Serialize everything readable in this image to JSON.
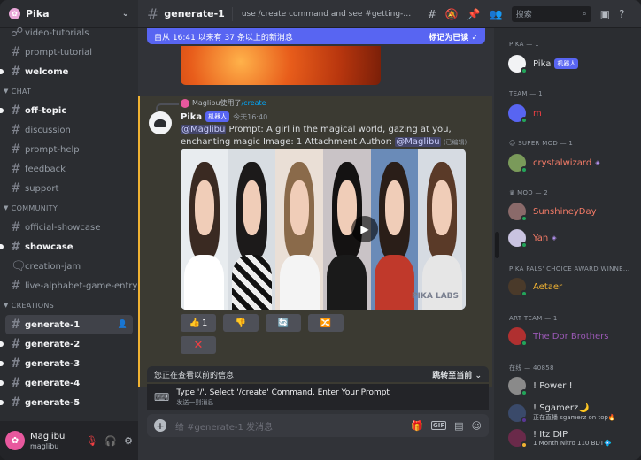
{
  "server": {
    "name": "Pika"
  },
  "sidebar": {
    "channels_top": [
      {
        "name": "video-tutorials",
        "icon": "link-icon",
        "state": "normal"
      },
      {
        "name": "prompt-tutorial",
        "icon": "hash-icon",
        "state": "normal"
      },
      {
        "name": "welcome",
        "icon": "hash-icon",
        "state": "unread"
      }
    ],
    "cat_chat": "CHAT",
    "chat": [
      {
        "name": "off-topic",
        "state": "unread"
      },
      {
        "name": "discussion",
        "state": "normal"
      },
      {
        "name": "prompt-help",
        "state": "normal"
      },
      {
        "name": "feedback",
        "state": "normal"
      },
      {
        "name": "support",
        "state": "normal"
      }
    ],
    "cat_community": "COMMUNITY",
    "community": [
      {
        "name": "official-showcase",
        "state": "normal"
      },
      {
        "name": "showcase",
        "state": "unread"
      },
      {
        "name": "creation-jam",
        "icon": "forum-icon",
        "state": "normal"
      },
      {
        "name": "live-alphabet-game-entry",
        "state": "normal"
      }
    ],
    "cat_creations": "CREATIONS",
    "creations": [
      {
        "name": "generate-1",
        "state": "active"
      },
      {
        "name": "generate-2",
        "state": "unread"
      },
      {
        "name": "generate-3",
        "state": "unread"
      },
      {
        "name": "generate-4",
        "state": "unread"
      },
      {
        "name": "generate-5",
        "state": "unread"
      }
    ]
  },
  "user": {
    "name": "Maglibu",
    "tag": "maglibu"
  },
  "topbar": {
    "channel": "generate-1",
    "topic": "use /create command and see #getting-started f...",
    "search_placeholder": "搜索"
  },
  "chat": {
    "new_messages": "自从 16:41 以来有 37 条以上的新消息",
    "mark_read": "标记为已读",
    "reply_user": "Maglibu使用了",
    "reply_cmd": "/create",
    "author": "Pika",
    "bot_tag": "机器人",
    "time": "今天16:40",
    "mention": "@Maglibu",
    "text": " Prompt: A girl in the magical world, gazing at you, enchanting magic  Image: 1 Attachment  Author: ",
    "mention2": "@Maglibu",
    "edited": "(已编辑)",
    "thumb_count": "1",
    "watermark": "PIKA LABS",
    "older": "您正在查看以前的信息",
    "jump": "跳转至当前",
    "cmd_title": "Type '/', Select '/create' Command, Enter Your Prompt",
    "cmd_sub": "发送一则消息",
    "input_placeholder": "给 #generate-1 发消息",
    "gif_label": "GIF"
  },
  "members": {
    "cat_pika": "PIKA — 1",
    "pika": {
      "name": "Pika",
      "tag": "机器人"
    },
    "cat_team": "TEAM — 1",
    "team": {
      "name": "m",
      "color": "#f23f43"
    },
    "cat_supermod": "SUPER MOD — 1",
    "supermod": {
      "name": "crystalwizard",
      "color": "#f47b67"
    },
    "cat_mod": "MOD — 2",
    "mods": [
      {
        "name": "SunshineyDay",
        "color": "#f47b67"
      },
      {
        "name": "Yan",
        "color": "#f47b67"
      }
    ],
    "cat_award": "PIKA PALS' CHOICE AWARD WINNE...",
    "award": {
      "name": "Aetaer",
      "color": "#f0b232"
    },
    "cat_art": "ART TEAM — 1",
    "art": {
      "name": "The Dor Brothers",
      "color": "#9b59b6"
    },
    "cat_online": "在线 — 40858",
    "online": [
      {
        "name": "! Power !",
        "sub": ""
      },
      {
        "name": "! Sgamerz🌙",
        "sub": "正在直播 sgamerz on top🔥"
      },
      {
        "name": "! Itz DIP",
        "sub": "1 Month Nitro 110 BDT💠"
      }
    ]
  }
}
